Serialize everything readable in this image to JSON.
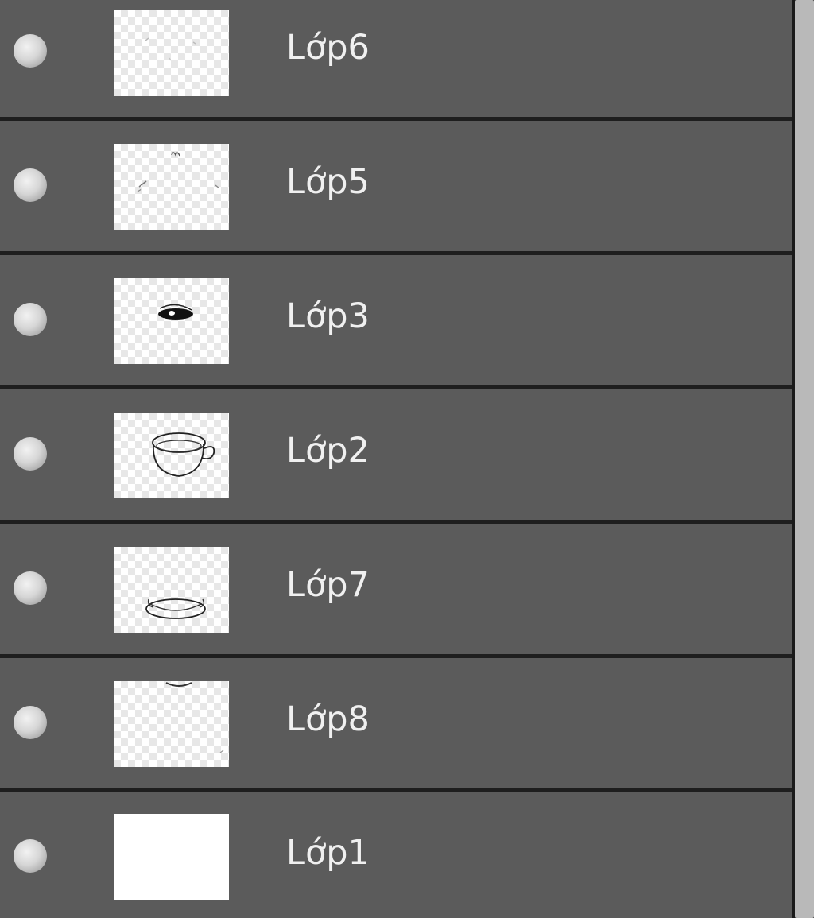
{
  "layers_panel": {
    "layers": [
      {
        "name": "Lớp6",
        "thumbnail": "transparent-with-faint-marks",
        "visible_icon": "visibility-dot-icon"
      },
      {
        "name": "Lớp5",
        "thumbnail": "transparent-with-small-strokes",
        "visible_icon": "visibility-dot-icon"
      },
      {
        "name": "Lớp3",
        "thumbnail": "eye-shape-drawing",
        "visible_icon": "visibility-dot-icon"
      },
      {
        "name": "Lớp2",
        "thumbnail": "cup-sketch-drawing",
        "visible_icon": "visibility-dot-icon"
      },
      {
        "name": "Lớp7",
        "thumbnail": "saucer-sketch-drawing",
        "visible_icon": "visibility-dot-icon"
      },
      {
        "name": "Lớp8",
        "thumbnail": "transparent-with-edge-mark",
        "visible_icon": "visibility-dot-icon"
      },
      {
        "name": "Lớp1",
        "thumbnail": "solid-white",
        "visible_icon": "visibility-dot-icon"
      }
    ]
  },
  "colors": {
    "row_background": "#5b5b5b",
    "row_separator": "#1e1e1e",
    "text": "#f0f0f0",
    "scrollbar": "#b9b9b9"
  }
}
